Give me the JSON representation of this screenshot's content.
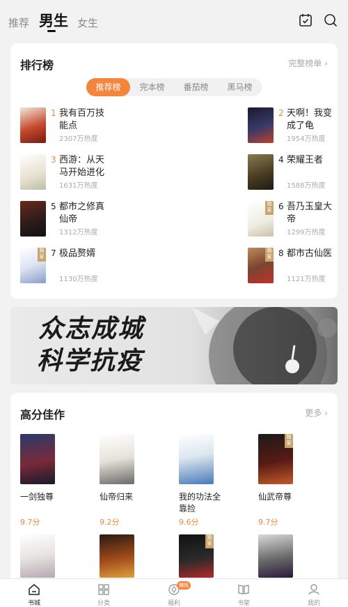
{
  "top_tabs": [
    "推荐",
    "男生",
    "女生"
  ],
  "ranking": {
    "title": "排行榜",
    "more": "完整榜单 ›",
    "segments": [
      "推荐榜",
      "完本榜",
      "番茄榜",
      "黑马榜"
    ],
    "items": [
      {
        "rank": "1",
        "name": "我有百万技能点",
        "heat": "2307万热度",
        "color": "#b22a1e"
      },
      {
        "rank": "2",
        "name": "天啊！我变成了龟",
        "heat": "1954万热度",
        "color": "#2a2a4a"
      },
      {
        "rank": "3",
        "name": "西游：从天马开始进化",
        "heat": "1631万热度",
        "color": "#d9d4c4"
      },
      {
        "rank": "4",
        "name": "荣耀王者",
        "heat": "1588万热度",
        "color": "#4b3d24"
      },
      {
        "rank": "5",
        "name": "都市之修真仙帝",
        "heat": "1312万热度",
        "color": "#3a1e1a"
      },
      {
        "rank": "6",
        "name": "吾乃玉皇大帝",
        "heat": "1299万热度",
        "color": "#e8e6dc"
      },
      {
        "rank": "7",
        "name": "极品赘婿",
        "heat": "1130万热度",
        "color": "#cdd6ea"
      },
      {
        "rank": "8",
        "name": "都市古仙医",
        "heat": "1121万热度",
        "color": "#7a4630"
      }
    ],
    "exclusive_badge": "独家"
  },
  "banner": {
    "line1": "众志成城",
    "line2": "科学抗疫"
  },
  "high_rated": {
    "title": "高分佳作",
    "more": "更多 ›",
    "items": [
      {
        "name": "一剑独尊",
        "score": "9.7分",
        "color": "#3b2a4a"
      },
      {
        "name": "仙帝归来",
        "score": "9.2分",
        "color": "#e5e2d8"
      },
      {
        "name": "我的功法全靠捡",
        "score": "9.6分",
        "color": "#dbe6ee"
      },
      {
        "name": "仙武帝尊",
        "score": "9.7分",
        "color": "#3a1a14"
      },
      {
        "color": "#e7e3e0"
      },
      {
        "color": "#5a2a14"
      },
      {
        "color": "#1a1a1a"
      },
      {
        "color": "#6a6a6a"
      }
    ]
  },
  "bottom_nav": {
    "items": [
      "书城",
      "分类",
      "福利",
      "书架",
      "我的"
    ],
    "welfare_badge": "赚钱"
  }
}
